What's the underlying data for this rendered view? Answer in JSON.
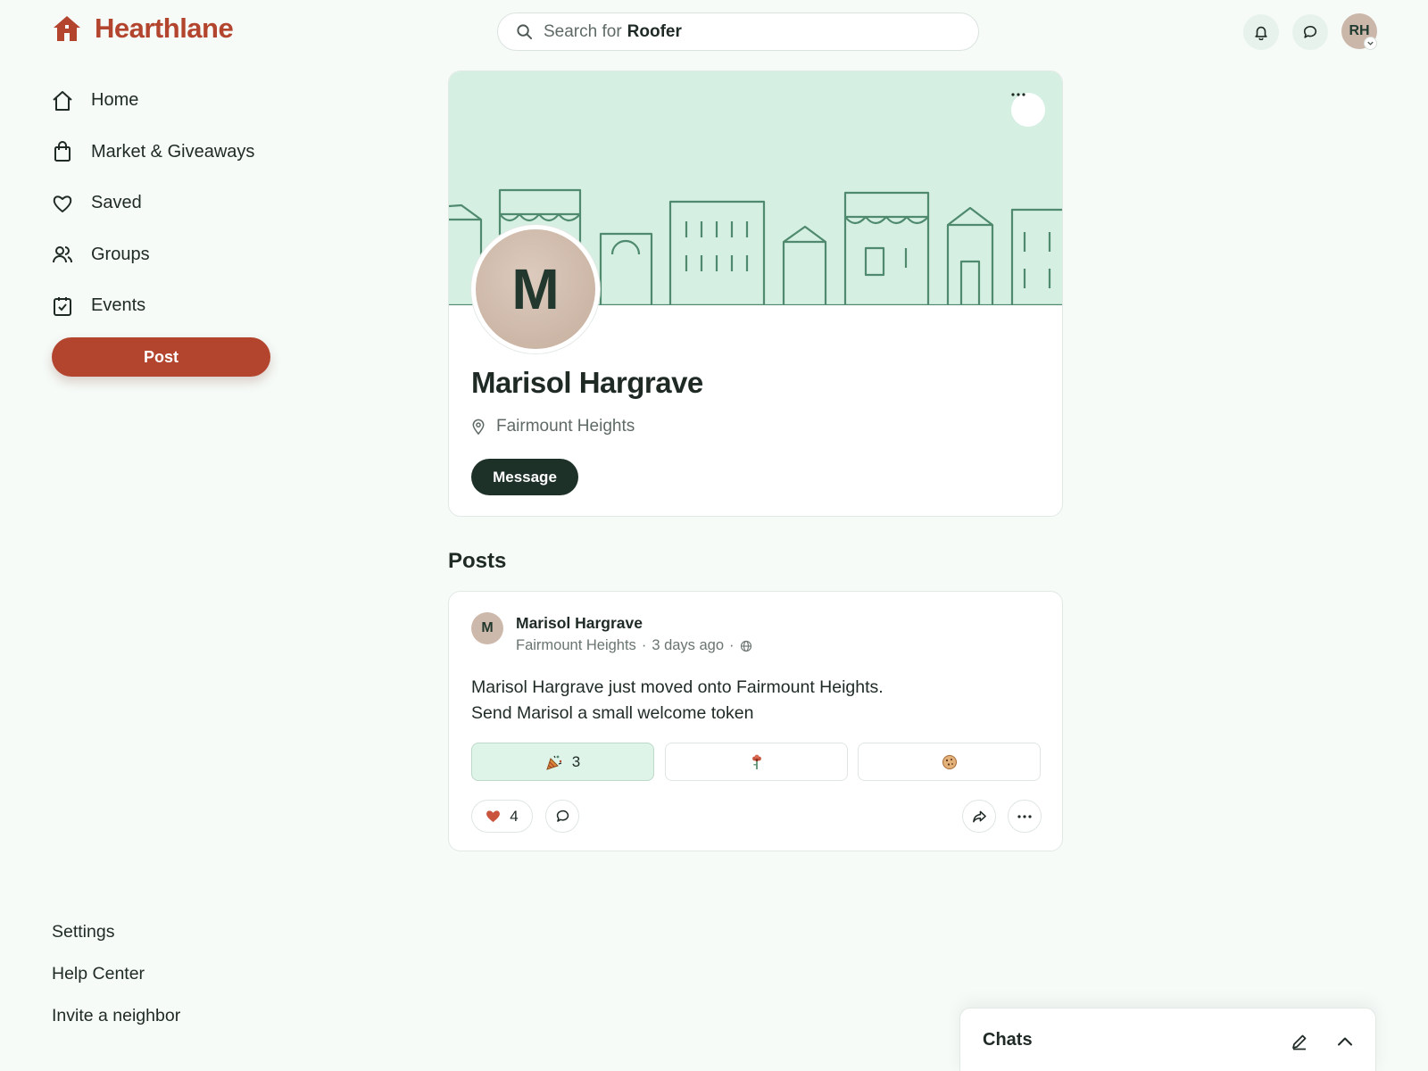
{
  "brand": {
    "name": "Hearthlane",
    "icon": "house-icon",
    "color": "#b3452f"
  },
  "sidebar": {
    "items": [
      {
        "label": "Home",
        "icon": "home-icon"
      },
      {
        "label": "Market & Giveaways",
        "icon": "shopping-bag-icon"
      },
      {
        "label": "Saved",
        "icon": "heart-icon"
      },
      {
        "label": "Groups",
        "icon": "people-icon"
      },
      {
        "label": "Events",
        "icon": "calendar-check-icon"
      }
    ],
    "post_label": "Post",
    "footer": [
      "Settings",
      "Help Center",
      "Invite a neighbor"
    ]
  },
  "search": {
    "prefix": "Search for",
    "term": "Roofer"
  },
  "header": {
    "notifications_icon": "bell-icon",
    "messages_icon": "chat-bubble-icon",
    "user_initials": "RH"
  },
  "profile": {
    "initial": "M",
    "name": "Marisol Hargrave",
    "location": "Fairmount Heights",
    "message_label": "Message"
  },
  "posts": {
    "heading": "Posts",
    "items": [
      {
        "author_initial": "M",
        "author": "Marisol Hargrave",
        "neighborhood": "Fairmount Heights",
        "time": "3 days ago",
        "visibility_icon": "globe-icon",
        "body_line1": "Marisol Hargrave just moved onto Fairmount Heights.",
        "body_line2": "Send Marisol a small welcome token",
        "tokens": [
          {
            "icon": "party-popper-icon",
            "count": "3",
            "selected": true
          },
          {
            "icon": "flower-icon",
            "count": "",
            "selected": false
          },
          {
            "icon": "cookie-icon",
            "count": "",
            "selected": false
          }
        ],
        "likes": "4"
      }
    ]
  },
  "chats": {
    "title": "Chats"
  },
  "colors": {
    "accent": "#b3452f",
    "banner": "#d5efe2",
    "dark_button": "#1e3128",
    "token_selected": "#def4e8"
  }
}
